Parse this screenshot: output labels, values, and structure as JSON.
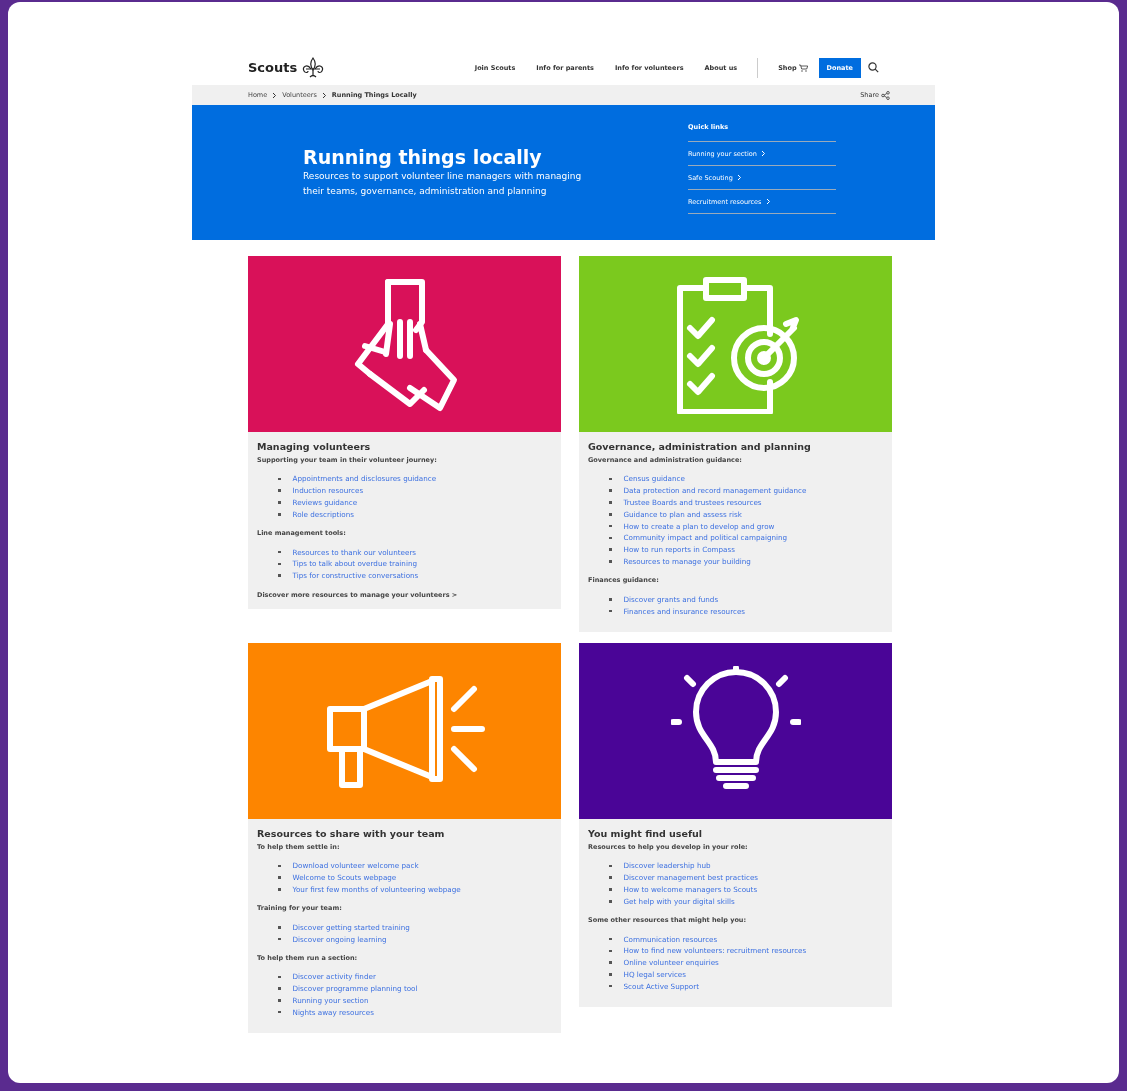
{
  "header": {
    "logo": "Scouts",
    "nav": [
      "Join Scouts",
      "Info for parents",
      "Info for volunteers",
      "About us"
    ],
    "shop": "Shop",
    "donate": "Donate"
  },
  "breadcrumb": {
    "items": [
      "Home",
      "Volunteers"
    ],
    "current": "Running Things Locally",
    "share": "Share"
  },
  "hero": {
    "title": "Running things locally",
    "subtitle": "Resources to support volunteer line managers with managing their teams, governance, administration and planning",
    "quick_links_title": "Quick links",
    "quick_links": [
      "Running your section",
      "Safe Scouting",
      "Recruitment resources"
    ]
  },
  "cards": [
    {
      "kind": "hands",
      "color": "#d91159",
      "title": "Managing volunteers",
      "groups": [
        {
          "heading": "Supporting your team in their volunteer journey:",
          "links": [
            "Appointments and disclosures guidance",
            "Induction resources",
            "Reviews guidance",
            "Role descriptions"
          ]
        },
        {
          "heading": "Line management tools:",
          "links": [
            "Resources to thank our volunteers",
            "Tips to talk about overdue training",
            "Tips for constructive conversations"
          ]
        }
      ],
      "footer": "Discover more resources to manage your volunteers >"
    },
    {
      "kind": "clipboard",
      "color": "#7bc91e",
      "title": "Governance, administration and planning",
      "groups": [
        {
          "heading": "Governance and administration guidance:",
          "links": [
            "Census guidance",
            "Data protection and record management guidance",
            "Trustee Boards and trustees resources",
            "Guidance to plan and assess risk",
            "How to create a plan to develop and grow",
            "Community impact and political campaigning",
            "How to run reports in Compass",
            "Resources to manage your building"
          ]
        },
        {
          "heading": "Finances guidance:",
          "links": [
            "Discover grants and funds",
            "Finances and insurance resources"
          ]
        }
      ]
    },
    {
      "kind": "megaphone",
      "color": "#fd8500",
      "title": "Resources to share with your team",
      "groups": [
        {
          "heading": "To help them settle in:",
          "links": [
            "Download volunteer welcome pack",
            "Welcome to Scouts webpage",
            "Your first few months of volunteering webpage"
          ]
        },
        {
          "heading": "Training for your team:",
          "links": [
            "Discover getting started training",
            "Discover ongoing learning"
          ]
        },
        {
          "heading": "To help them run a section:",
          "links": [
            "Discover activity finder",
            "Discover programme planning tool",
            "Running your section",
            "Nights away resources"
          ]
        }
      ]
    },
    {
      "kind": "bulb",
      "color": "#4a0597",
      "title": "You might find useful",
      "groups": [
        {
          "heading": "Resources to help you develop in your role:",
          "links": [
            "Discover leadership hub",
            "Discover management best practices",
            "How to welcome managers to Scouts",
            "Get help with your digital skills"
          ]
        },
        {
          "heading": "Some other resources that might help you:",
          "links": [
            "Communication resources",
            "How to find new volunteers: recruitment resources",
            "Online volunteer enquiries",
            "HQ legal services",
            "Scout Active Support"
          ]
        }
      ]
    }
  ]
}
